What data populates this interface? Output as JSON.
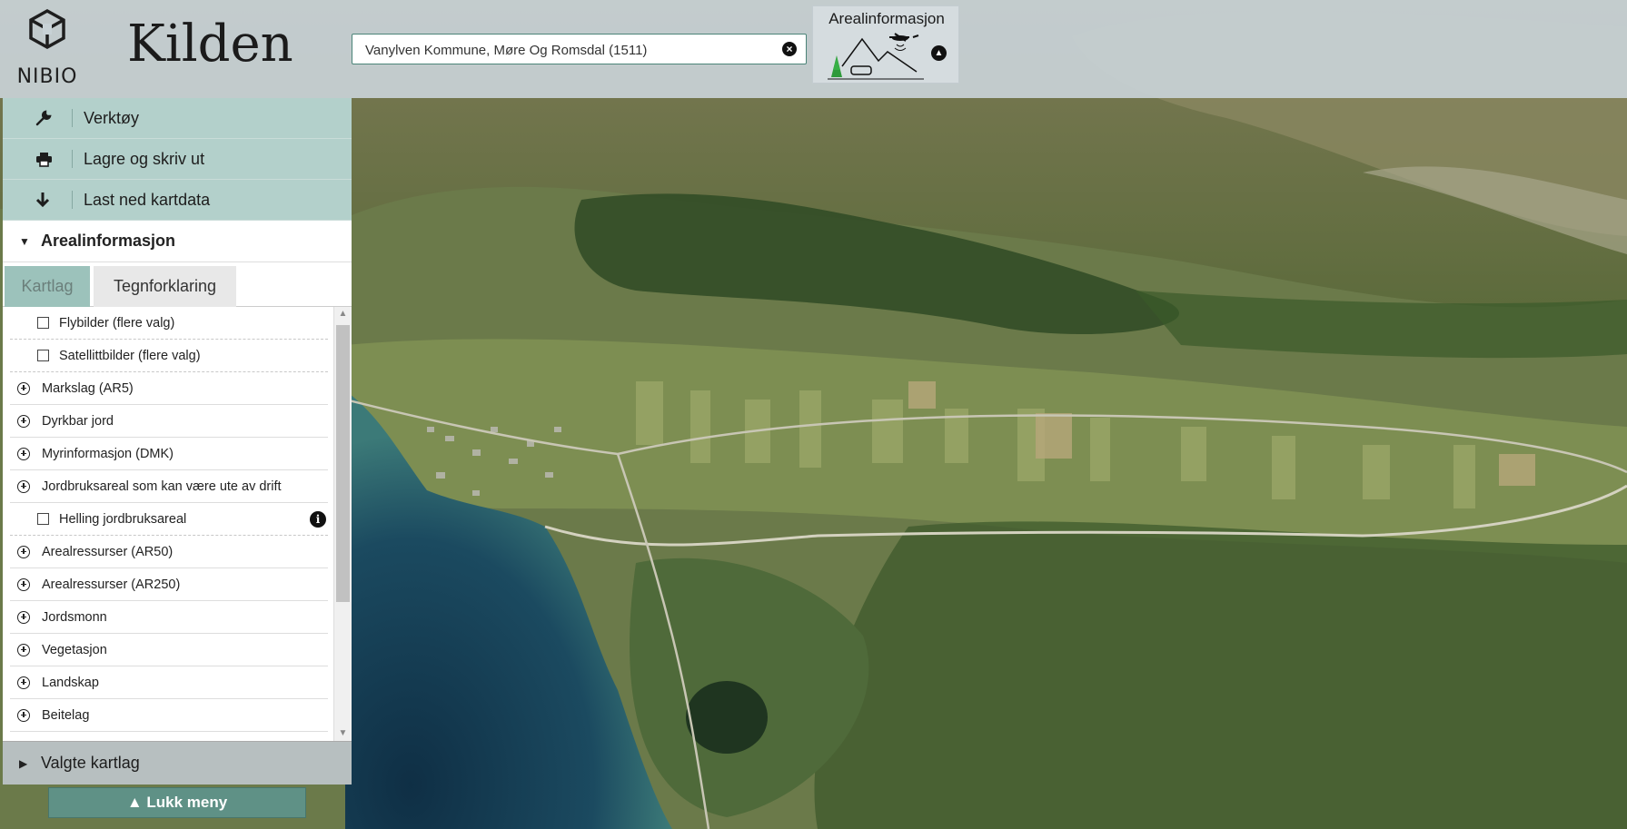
{
  "header": {
    "logo_text": "NIBIO",
    "app_title": "Kilden",
    "search": {
      "value": "Vanylven Kommune, Møre Og Romsdal (1511)",
      "clear_icon": "times-circle-icon"
    },
    "theme": {
      "title": "Arealinformasjon",
      "collapse_icon": "chevron-up-icon"
    }
  },
  "sidebar": {
    "tools": [
      {
        "label": "Verktøy",
        "icon": "wrench-icon"
      },
      {
        "label": "Lagre og skriv ut",
        "icon": "print-icon"
      },
      {
        "label": "Last ned kartdata",
        "icon": "download-arrow-icon"
      }
    ],
    "section_title": "Arealinformasjon",
    "tabs": [
      {
        "label": "Kartlag",
        "active": true
      },
      {
        "label": "Tegnforklaring",
        "active": false
      }
    ],
    "layers": [
      {
        "label": "Flybilder (flere valg)",
        "type": "checkbox",
        "checked": false
      },
      {
        "label": "Satellittbilder (flere valg)",
        "type": "checkbox",
        "checked": false
      },
      {
        "label": "Markslag (AR5)",
        "type": "group"
      },
      {
        "label": "Dyrkbar jord",
        "type": "group"
      },
      {
        "label": "Myrinformasjon (DMK)",
        "type": "group"
      },
      {
        "label": "Jordbruksareal som kan være ute av drift",
        "type": "group"
      },
      {
        "label": "Helling jordbruksareal",
        "type": "checkbox",
        "checked": false,
        "info": true
      },
      {
        "label": "Arealressurser (AR50)",
        "type": "group"
      },
      {
        "label": "Arealressurser (AR250)",
        "type": "group"
      },
      {
        "label": "Jordsmonn",
        "type": "group"
      },
      {
        "label": "Vegetasjon",
        "type": "group"
      },
      {
        "label": "Landskap",
        "type": "group"
      },
      {
        "label": "Beitelag",
        "type": "group"
      }
    ],
    "selected_layers_label": "Valgte kartlag",
    "close_menu_label": "▲ Lukk meny"
  },
  "colors": {
    "tool_row_bg": "#b3d0cb",
    "active_tab_bg": "#9cc2bb",
    "close_button_bg": "#5f9186",
    "search_border": "#4b8478"
  }
}
